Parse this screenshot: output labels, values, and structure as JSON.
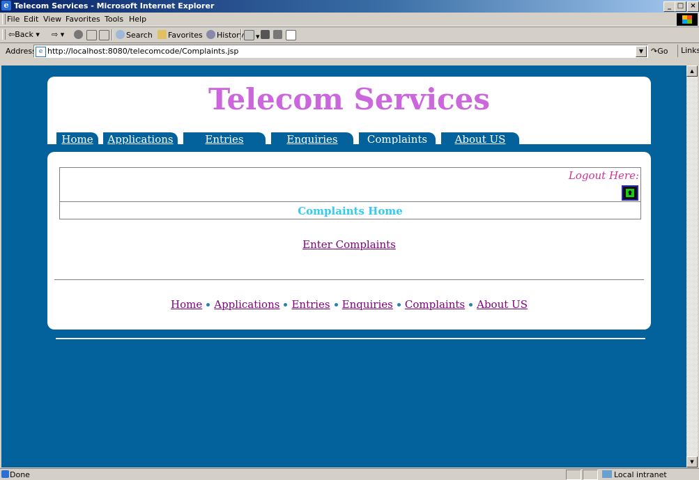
{
  "window": {
    "title": "Telecom Services - Microsoft Internet Explorer",
    "minimize": "_",
    "maximize": "□",
    "close": "×"
  },
  "menu": [
    "File",
    "Edit",
    "View",
    "Favorites",
    "Tools",
    "Help"
  ],
  "toolbar": {
    "back": "⇦Back ▾",
    "forward": "⇨ ▾",
    "search": "Search",
    "favorites": "Favorites",
    "history": "History"
  },
  "address": {
    "label": "Address",
    "url": "http://localhost:8080/telecomcode/Complaints.jsp",
    "go": "Go",
    "links": "Links"
  },
  "page": {
    "site_title": "Telecom Services",
    "tabs": [
      "Home",
      "Applications",
      "Entries",
      "Enquiries",
      "Complaints",
      "About US"
    ],
    "logout_text": "Logout Here:",
    "section_title": "Complaints Home",
    "enter_link": "Enter Complaints",
    "footer_links": [
      "Home",
      "Applications",
      "Entries",
      "Enquiries",
      "Complaints",
      "About US"
    ]
  },
  "status": {
    "text": "Done",
    "zone": "Local intranet"
  },
  "colors": {
    "page_background": "#03629c",
    "title_color": "#cc66dd",
    "link_color": "#800080",
    "section_color": "#33ccee"
  }
}
